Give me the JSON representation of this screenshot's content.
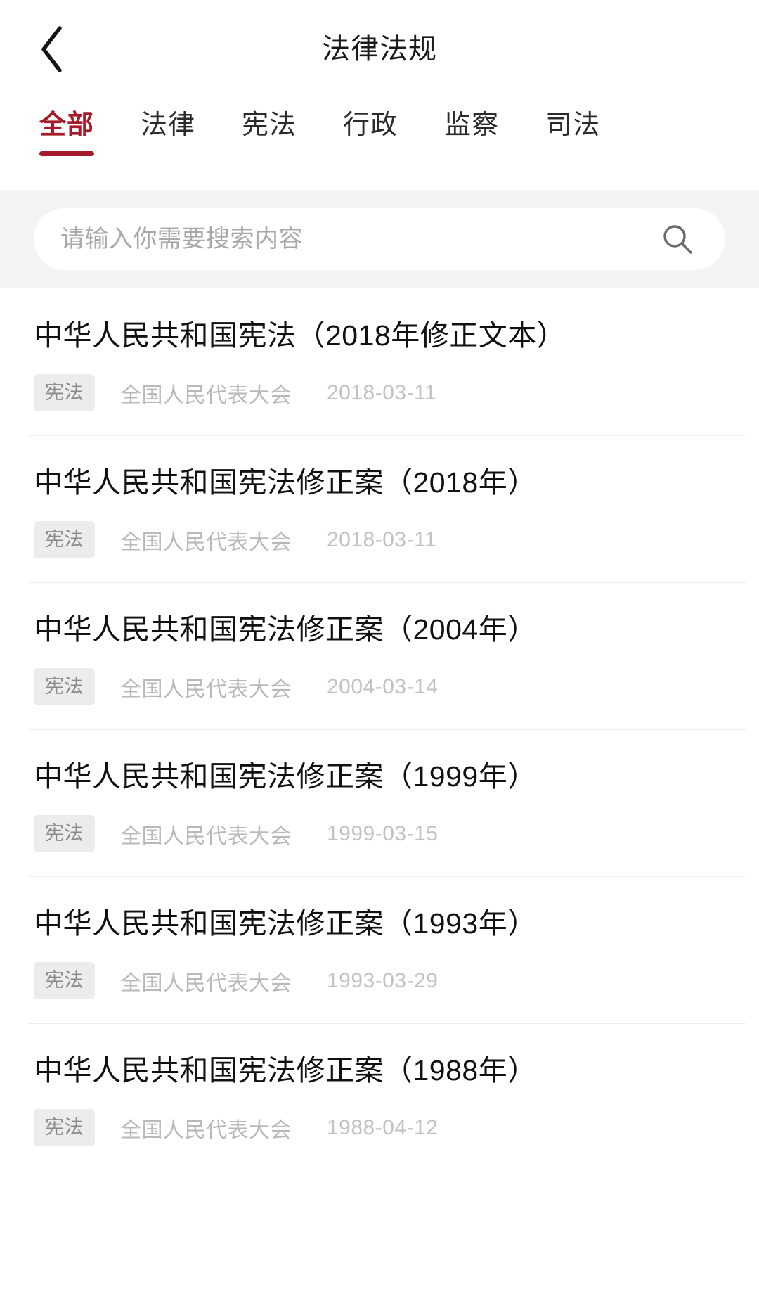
{
  "navbar": {
    "title": "法律法规",
    "back_icon": "chevron-left-icon"
  },
  "tabs": {
    "items": [
      {
        "label": "全部",
        "active": true
      },
      {
        "label": "法律",
        "active": false
      },
      {
        "label": "宪法",
        "active": false
      },
      {
        "label": "行政",
        "active": false
      },
      {
        "label": "监察",
        "active": false
      },
      {
        "label": "司法",
        "active": false
      }
    ],
    "active_color": "#a61b2b",
    "inactive_color": "#2b2b2b"
  },
  "search": {
    "placeholder": "请输入你需要搜索内容",
    "value": "",
    "icon": "search-icon",
    "background": "#f4f4f4",
    "field_background": "#ffffff"
  },
  "list": {
    "items": [
      {
        "title": "中华人民共和国宪法（2018年修正文本）",
        "badge": "宪法",
        "agency": "全国人民代表大会",
        "date": "2018-03-11"
      },
      {
        "title": "中华人民共和国宪法修正案（2018年）",
        "badge": "宪法",
        "agency": "全国人民代表大会",
        "date": "2018-03-11"
      },
      {
        "title": "中华人民共和国宪法修正案（2004年）",
        "badge": "宪法",
        "agency": "全国人民代表大会",
        "date": "2004-03-14"
      },
      {
        "title": "中华人民共和国宪法修正案（1999年）",
        "badge": "宪法",
        "agency": "全国人民代表大会",
        "date": "1999-03-15"
      },
      {
        "title": "中华人民共和国宪法修正案（1993年）",
        "badge": "宪法",
        "agency": "全国人民代表大会",
        "date": "1993-03-29"
      },
      {
        "title": "中华人民共和国宪法修正案（1988年）",
        "badge": "宪法",
        "agency": "全国人民代表大会",
        "date": "1988-04-12"
      }
    ]
  }
}
